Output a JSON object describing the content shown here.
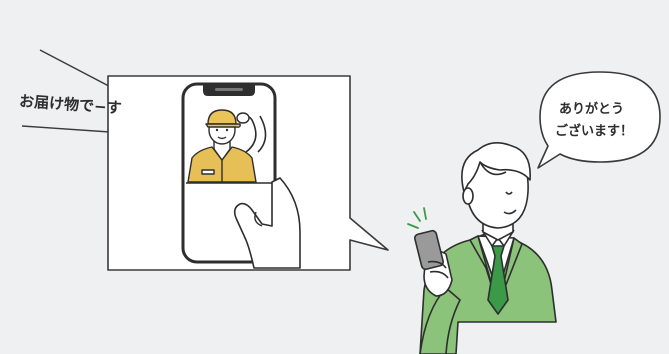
{
  "speech": {
    "delivery_text": "お届け物で−す",
    "reply_line1": "ありがとう",
    "reply_line2": "ございます！"
  },
  "colors": {
    "background": "#eef0f1",
    "outline": "#3a3a3a",
    "suit_green": "#8cc37a",
    "tie_green": "#3a9a48",
    "cap_yellow": "#e8c45a",
    "uniform_yellow": "#e6bf57"
  },
  "icons": {
    "courier": "delivery-person-illustration",
    "phone": "smartphone-illustration",
    "man": "businessman-illustration"
  }
}
